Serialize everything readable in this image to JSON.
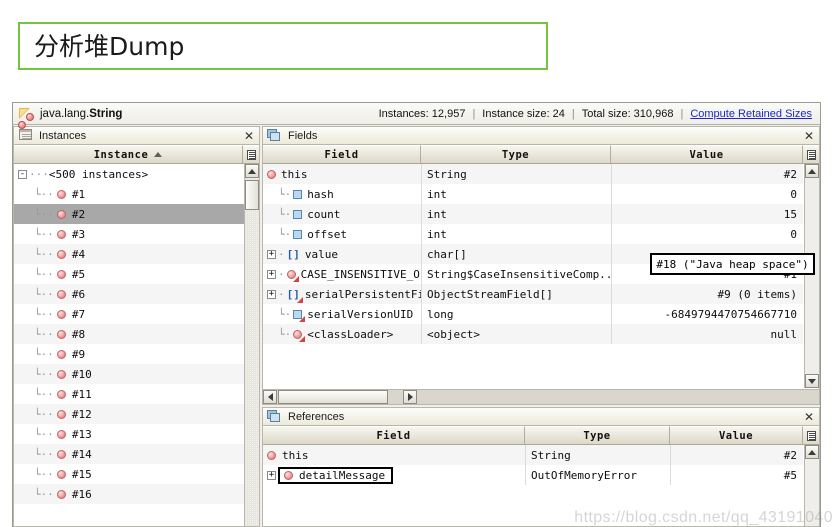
{
  "slide": {
    "title": "分析堆Dump",
    "title_border_color": "#76c442"
  },
  "watermark": "https://blog.csdn.net/qq_43191040",
  "class_bar": {
    "icon": "class-icon",
    "package": "java.lang.",
    "class_name": "String",
    "instances_label": "Instances: 12,957",
    "instance_size_label": "Instance size: 24",
    "total_size_label": "Total size: 310,968",
    "compute_link": "Compute Retained Sizes",
    "separator": "|",
    "link_color": "#1a28c8"
  },
  "instances_panel": {
    "title": "Instances",
    "close_label": "✕",
    "column_header": "Instance",
    "sort_direction": "asc",
    "root": {
      "expander": "-",
      "label": "<500 instances>"
    },
    "rows": [
      {
        "label": "#1",
        "selected": false
      },
      {
        "label": "#2",
        "selected": true
      },
      {
        "label": "#3",
        "selected": false
      },
      {
        "label": "#4",
        "selected": false
      },
      {
        "label": "#5",
        "selected": false
      },
      {
        "label": "#6",
        "selected": false
      },
      {
        "label": "#7",
        "selected": false
      },
      {
        "label": "#8",
        "selected": false
      },
      {
        "label": "#9",
        "selected": false
      },
      {
        "label": "#10",
        "selected": false
      },
      {
        "label": "#11",
        "selected": false
      },
      {
        "label": "#12",
        "selected": false
      },
      {
        "label": "#13",
        "selected": false
      },
      {
        "label": "#14",
        "selected": false
      },
      {
        "label": "#15",
        "selected": false
      },
      {
        "label": "#16",
        "selected": false
      }
    ]
  },
  "fields_panel": {
    "title": "Fields",
    "close_label": "✕",
    "columns": [
      "Field",
      "Type",
      "Value"
    ],
    "rows": [
      {
        "expander": "",
        "icon": "object-dot-icon",
        "static": false,
        "indent": 0,
        "field": "this",
        "type": "String",
        "value": "#2"
      },
      {
        "expander": "",
        "icon": "primitive-square-icon",
        "static": false,
        "indent": 1,
        "field": "hash",
        "type": "int",
        "value": "0"
      },
      {
        "expander": "",
        "icon": "primitive-square-icon",
        "static": false,
        "indent": 1,
        "field": "count",
        "type": "int",
        "value": "15"
      },
      {
        "expander": "",
        "icon": "primitive-square-icon",
        "static": false,
        "indent": 1,
        "field": "offset",
        "type": "int",
        "value": "0"
      },
      {
        "expander": "+",
        "icon": "array-icon",
        "static": false,
        "indent": 1,
        "field": "value",
        "type": "char[]",
        "value": ""
      },
      {
        "expander": "+",
        "icon": "object-dot-icon",
        "static": true,
        "indent": 1,
        "field": "CASE_INSENSITIVE_OI",
        "type": "String$CaseInsensitiveComp...",
        "value": "#1"
      },
      {
        "expander": "+",
        "icon": "array-icon",
        "static": true,
        "indent": 1,
        "field": "serialPersistentFi",
        "type": "ObjectStreamField[]",
        "value": "#9 (0 items)"
      },
      {
        "expander": "",
        "icon": "primitive-square-icon",
        "static": true,
        "indent": 1,
        "field": "serialVersionUID",
        "type": "long",
        "value": "-6849794470754667710"
      },
      {
        "expander": "",
        "icon": "object-dot-icon",
        "static": true,
        "indent": 1,
        "field": "<classLoader>",
        "type": "<object>",
        "value": "null"
      }
    ],
    "annotation_value": "#18 (\"Java heap space\")"
  },
  "references_panel": {
    "title": "References",
    "close_label": "✕",
    "columns": [
      "Field",
      "Type",
      "Value"
    ],
    "rows": [
      {
        "expander": "",
        "icon": "object-dot-icon",
        "indent": 0,
        "field": "this",
        "type": "String",
        "value": "#2",
        "highlighted": false
      },
      {
        "expander": "+",
        "icon": "object-dot-icon",
        "indent": 1,
        "field": "detailMessage",
        "type": "OutOfMemoryError",
        "value": "#5",
        "highlighted": true
      }
    ]
  }
}
